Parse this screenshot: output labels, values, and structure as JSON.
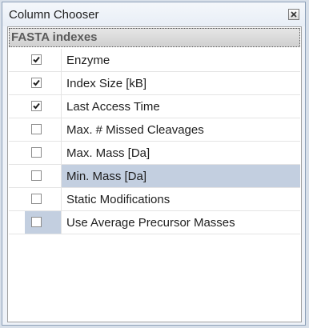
{
  "window": {
    "title": "Column Chooser",
    "close_icon": "close-icon"
  },
  "group": {
    "label": "FASTA indexes"
  },
  "columns": [
    {
      "label": "Enzyme",
      "checked": true,
      "selected": false,
      "hover": false
    },
    {
      "label": "Index Size [kB]",
      "checked": true,
      "selected": false,
      "hover": false
    },
    {
      "label": "Last Access Time",
      "checked": true,
      "selected": false,
      "hover": false
    },
    {
      "label": "Max. # Missed Cleavages",
      "checked": false,
      "selected": false,
      "hover": false
    },
    {
      "label": "Max. Mass [Da]",
      "checked": false,
      "selected": false,
      "hover": false
    },
    {
      "label": "Min. Mass [Da]",
      "checked": false,
      "selected": true,
      "hover": false
    },
    {
      "label": "Static Modifications",
      "checked": false,
      "selected": false,
      "hover": false
    },
    {
      "label": "Use Average Precursor Masses",
      "checked": false,
      "selected": false,
      "hover": true
    }
  ],
  "colors": {
    "selection": "#c3cfe0",
    "check": "#1e1e1e"
  }
}
